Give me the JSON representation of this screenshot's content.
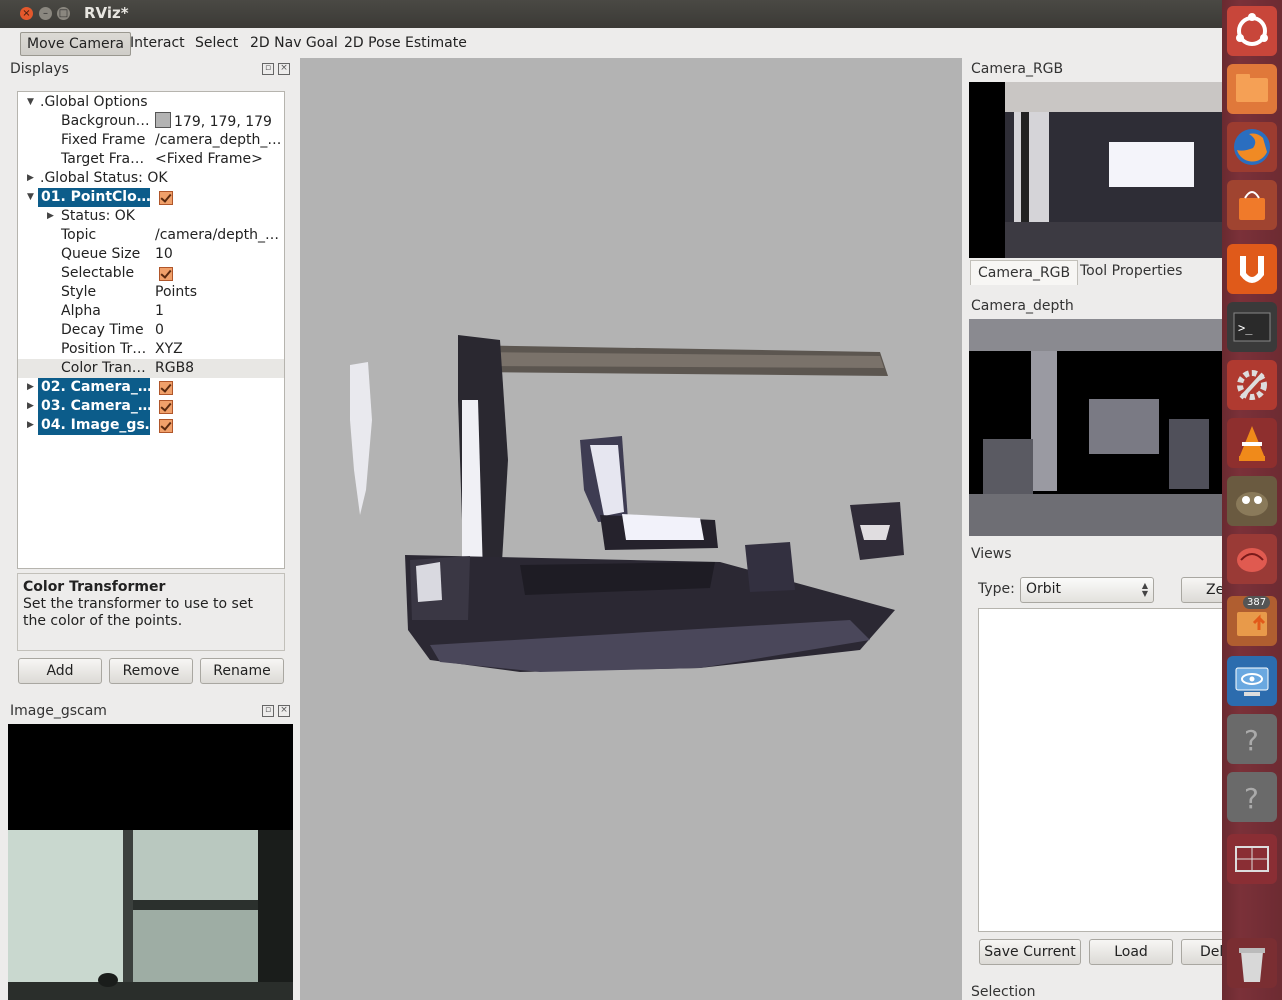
{
  "window": {
    "title": "RViz*",
    "close_label": "×",
    "min_label": "–",
    "max_label": "□"
  },
  "toolbar": {
    "tools": [
      "Move Camera",
      "Interact",
      "Select",
      "2D Nav Goal",
      "2D Pose Estimate"
    ]
  },
  "displays": {
    "title": "Displays",
    "tree": {
      "global_options": ".Global Options",
      "background_label": "Backgroun…",
      "background_value": "179, 179, 179",
      "fixed_frame_label": "Fixed Frame",
      "fixed_frame_value": "/camera_depth_…",
      "target_frame_label": "Target Fra…",
      "target_frame_value": "<Fixed Frame>",
      "global_status": ".Global Status: OK",
      "pointcloud": "01. PointClo…",
      "status": "Status: OK",
      "topic_label": "Topic",
      "topic_value": "/camera/depth_…",
      "queue_label": "Queue Size",
      "queue_value": "10",
      "selectable_label": "Selectable",
      "style_label": "Style",
      "style_value": "Points",
      "alpha_label": "Alpha",
      "alpha_value": "1",
      "decay_label": "Decay Time",
      "decay_value": "0",
      "postr_label": "Position Tr…",
      "postr_value": "XYZ",
      "colortr_label": "Color Tran…",
      "colortr_value": "RGB8",
      "camera2": "02. Camera_…",
      "camera3": "03. Camera_…",
      "image4": "04. Image_gs…"
    },
    "description_title": "Color Transformer",
    "description_text": "Set the transformer to use to set the color of the points.",
    "add_button": "Add",
    "remove_button": "Remove",
    "rename_button": "Rename"
  },
  "image_gscam": {
    "title": "Image_gscam"
  },
  "right": {
    "camera_rgb_title": "Camera_RGB",
    "tab_camera_rgb": "Camera_RGB",
    "tab_tool_properties": "Tool Properties",
    "camera_depth_title": "Camera_depth",
    "views_title": "Views",
    "type_label": "Type:",
    "type_value": "Orbit",
    "zero_button": "Zero",
    "save_current_button": "Save Current",
    "load_button": "Load",
    "delete_button": "Dele",
    "selection_title": "Selection"
  },
  "launcher": {
    "badge": "387"
  },
  "colors": {
    "tree_highlight": "#0c5c8a",
    "view_background": "#b3b3b3",
    "launcher": "#7b3139"
  }
}
